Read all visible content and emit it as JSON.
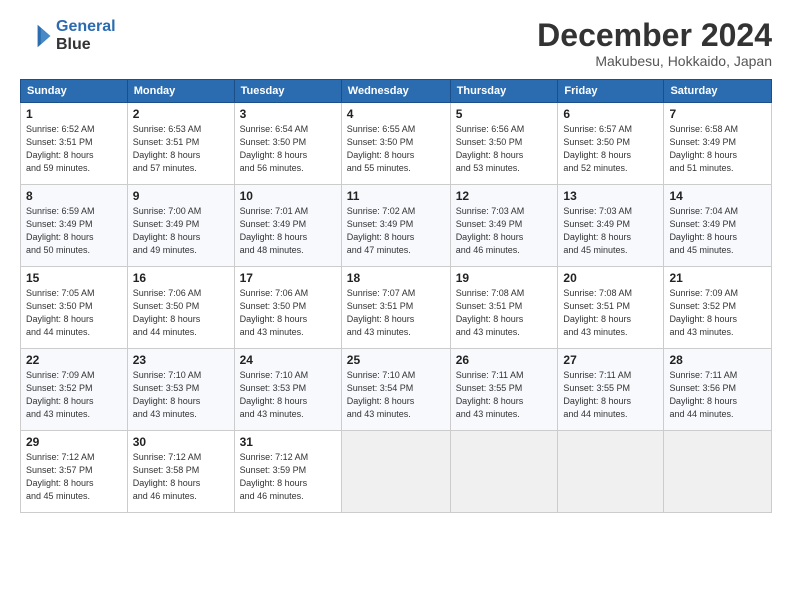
{
  "header": {
    "logo_line1": "General",
    "logo_line2": "Blue",
    "month": "December 2024",
    "location": "Makubesu, Hokkaido, Japan"
  },
  "weekdays": [
    "Sunday",
    "Monday",
    "Tuesday",
    "Wednesday",
    "Thursday",
    "Friday",
    "Saturday"
  ],
  "weeks": [
    [
      {
        "day": "1",
        "info": "Sunrise: 6:52 AM\nSunset: 3:51 PM\nDaylight: 8 hours\nand 59 minutes."
      },
      {
        "day": "2",
        "info": "Sunrise: 6:53 AM\nSunset: 3:51 PM\nDaylight: 8 hours\nand 57 minutes."
      },
      {
        "day": "3",
        "info": "Sunrise: 6:54 AM\nSunset: 3:50 PM\nDaylight: 8 hours\nand 56 minutes."
      },
      {
        "day": "4",
        "info": "Sunrise: 6:55 AM\nSunset: 3:50 PM\nDaylight: 8 hours\nand 55 minutes."
      },
      {
        "day": "5",
        "info": "Sunrise: 6:56 AM\nSunset: 3:50 PM\nDaylight: 8 hours\nand 53 minutes."
      },
      {
        "day": "6",
        "info": "Sunrise: 6:57 AM\nSunset: 3:50 PM\nDaylight: 8 hours\nand 52 minutes."
      },
      {
        "day": "7",
        "info": "Sunrise: 6:58 AM\nSunset: 3:49 PM\nDaylight: 8 hours\nand 51 minutes."
      }
    ],
    [
      {
        "day": "8",
        "info": "Sunrise: 6:59 AM\nSunset: 3:49 PM\nDaylight: 8 hours\nand 50 minutes."
      },
      {
        "day": "9",
        "info": "Sunrise: 7:00 AM\nSunset: 3:49 PM\nDaylight: 8 hours\nand 49 minutes."
      },
      {
        "day": "10",
        "info": "Sunrise: 7:01 AM\nSunset: 3:49 PM\nDaylight: 8 hours\nand 48 minutes."
      },
      {
        "day": "11",
        "info": "Sunrise: 7:02 AM\nSunset: 3:49 PM\nDaylight: 8 hours\nand 47 minutes."
      },
      {
        "day": "12",
        "info": "Sunrise: 7:03 AM\nSunset: 3:49 PM\nDaylight: 8 hours\nand 46 minutes."
      },
      {
        "day": "13",
        "info": "Sunrise: 7:03 AM\nSunset: 3:49 PM\nDaylight: 8 hours\nand 45 minutes."
      },
      {
        "day": "14",
        "info": "Sunrise: 7:04 AM\nSunset: 3:49 PM\nDaylight: 8 hours\nand 45 minutes."
      }
    ],
    [
      {
        "day": "15",
        "info": "Sunrise: 7:05 AM\nSunset: 3:50 PM\nDaylight: 8 hours\nand 44 minutes."
      },
      {
        "day": "16",
        "info": "Sunrise: 7:06 AM\nSunset: 3:50 PM\nDaylight: 8 hours\nand 44 minutes."
      },
      {
        "day": "17",
        "info": "Sunrise: 7:06 AM\nSunset: 3:50 PM\nDaylight: 8 hours\nand 43 minutes."
      },
      {
        "day": "18",
        "info": "Sunrise: 7:07 AM\nSunset: 3:51 PM\nDaylight: 8 hours\nand 43 minutes."
      },
      {
        "day": "19",
        "info": "Sunrise: 7:08 AM\nSunset: 3:51 PM\nDaylight: 8 hours\nand 43 minutes."
      },
      {
        "day": "20",
        "info": "Sunrise: 7:08 AM\nSunset: 3:51 PM\nDaylight: 8 hours\nand 43 minutes."
      },
      {
        "day": "21",
        "info": "Sunrise: 7:09 AM\nSunset: 3:52 PM\nDaylight: 8 hours\nand 43 minutes."
      }
    ],
    [
      {
        "day": "22",
        "info": "Sunrise: 7:09 AM\nSunset: 3:52 PM\nDaylight: 8 hours\nand 43 minutes."
      },
      {
        "day": "23",
        "info": "Sunrise: 7:10 AM\nSunset: 3:53 PM\nDaylight: 8 hours\nand 43 minutes."
      },
      {
        "day": "24",
        "info": "Sunrise: 7:10 AM\nSunset: 3:53 PM\nDaylight: 8 hours\nand 43 minutes."
      },
      {
        "day": "25",
        "info": "Sunrise: 7:10 AM\nSunset: 3:54 PM\nDaylight: 8 hours\nand 43 minutes."
      },
      {
        "day": "26",
        "info": "Sunrise: 7:11 AM\nSunset: 3:55 PM\nDaylight: 8 hours\nand 43 minutes."
      },
      {
        "day": "27",
        "info": "Sunrise: 7:11 AM\nSunset: 3:55 PM\nDaylight: 8 hours\nand 44 minutes."
      },
      {
        "day": "28",
        "info": "Sunrise: 7:11 AM\nSunset: 3:56 PM\nDaylight: 8 hours\nand 44 minutes."
      }
    ],
    [
      {
        "day": "29",
        "info": "Sunrise: 7:12 AM\nSunset: 3:57 PM\nDaylight: 8 hours\nand 45 minutes."
      },
      {
        "day": "30",
        "info": "Sunrise: 7:12 AM\nSunset: 3:58 PM\nDaylight: 8 hours\nand 46 minutes."
      },
      {
        "day": "31",
        "info": "Sunrise: 7:12 AM\nSunset: 3:59 PM\nDaylight: 8 hours\nand 46 minutes."
      },
      {
        "day": "",
        "info": ""
      },
      {
        "day": "",
        "info": ""
      },
      {
        "day": "",
        "info": ""
      },
      {
        "day": "",
        "info": ""
      }
    ]
  ]
}
